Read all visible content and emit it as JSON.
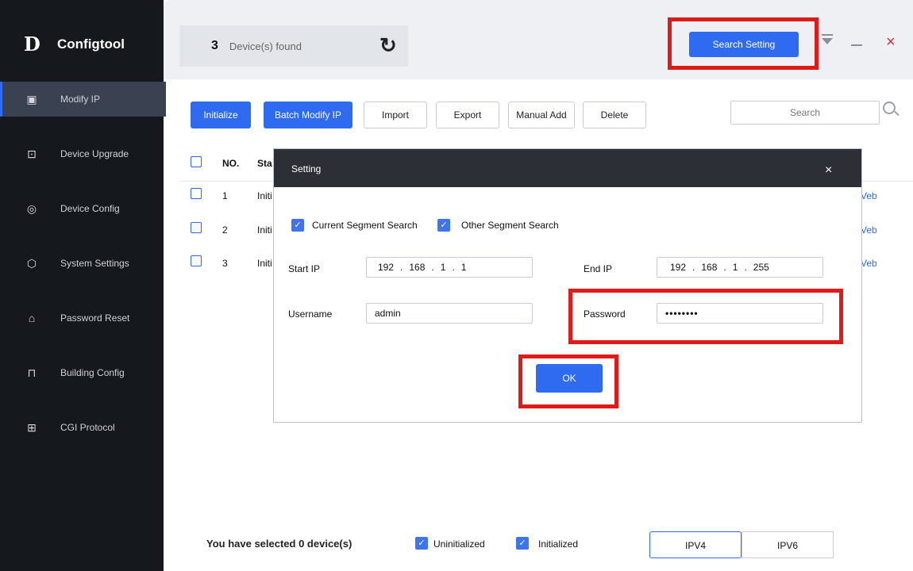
{
  "app": {
    "name": "Configtool",
    "logo_text": "D"
  },
  "sidebar": {
    "items": [
      {
        "label": "Modify IP",
        "icon": "ip-icon",
        "glyph": "▣"
      },
      {
        "label": "Device Upgrade",
        "icon": "upgrade-icon",
        "glyph": "⊡"
      },
      {
        "label": "Device Config",
        "icon": "config-icon",
        "glyph": "◎"
      },
      {
        "label": "System Settings",
        "icon": "settings-icon",
        "glyph": "⬡"
      },
      {
        "label": "Password Reset",
        "icon": "lock-icon",
        "glyph": "⌂"
      },
      {
        "label": "Building Config",
        "icon": "building-icon",
        "glyph": "⊓"
      },
      {
        "label": "CGI Protocol",
        "icon": "cgi-icon",
        "glyph": "⊞"
      }
    ]
  },
  "header": {
    "device_count": "3",
    "device_count_label": "Device(s) found",
    "search_setting": "Search Setting",
    "refresh_glyph": "↻",
    "close_glyph": "×"
  },
  "toolbar": {
    "initialize": "Initialize",
    "batch_modify": "Batch Modify IP",
    "import": "Import",
    "export": "Export",
    "manual_add": "Manual Add",
    "delete": "Delete",
    "search_placeholder": "Search"
  },
  "table": {
    "headers": {
      "no": "NO.",
      "status": "Sta"
    },
    "rows": [
      {
        "no": "1",
        "status": "Initi",
        "link": "Veb"
      },
      {
        "no": "2",
        "status": "Initi",
        "link": "Veb"
      },
      {
        "no": "3",
        "status": "Initi",
        "link": "Veb"
      }
    ]
  },
  "dialog": {
    "title": "Setting",
    "close": "×",
    "current_segment": "Current Segment Search",
    "other_segment": "Other Segment Search",
    "start_ip_label": "Start IP",
    "start_ip": [
      "192",
      "168",
      "1",
      "1"
    ],
    "end_ip_label": "End IP",
    "end_ip": [
      "192",
      "168",
      "1",
      "255"
    ],
    "username_label": "Username",
    "username": "admin",
    "password_label": "Password",
    "password": "••••••••",
    "ok": "OK",
    "ip_separator": "."
  },
  "footer": {
    "selected_text": "You have selected 0  device(s)",
    "uninitialized": "Uninitialized",
    "initialized": "Initialized",
    "ipv4": "IPV4",
    "ipv6": "IPV6"
  },
  "colors": {
    "accent": "#2f6bf0",
    "highlight": "#e01a1a",
    "sidebar": "#15181d"
  }
}
